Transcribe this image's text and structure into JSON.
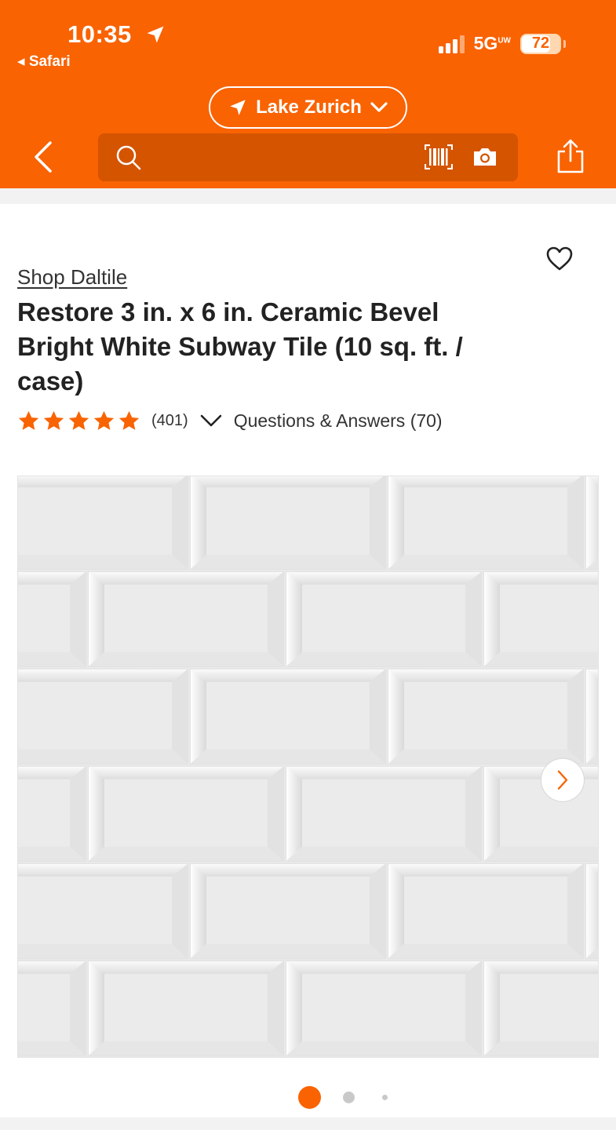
{
  "status_bar": {
    "time": "10:35",
    "back_app": "◂ Safari",
    "network": "5G",
    "network_sup": "UW",
    "battery": "72"
  },
  "header": {
    "store_name": "Lake Zurich",
    "search_placeholder": "",
    "accent_color": "#f96302"
  },
  "product": {
    "brand_link": "Shop Daltile",
    "title": "Restore 3 in. x 6 in. Ceramic Bevel Bright White Subway Tile (10 sq. ft. / case)",
    "rating_stars": 5,
    "review_count": "(401)",
    "qa_link": "Questions & Answers (70)"
  },
  "gallery": {
    "current_index": 1,
    "total_dots": 3
  },
  "icons": [
    "location-arrow-icon",
    "chevron-down-icon",
    "back-chevron-icon",
    "search-icon",
    "barcode-icon",
    "camera-icon",
    "share-icon",
    "heart-icon",
    "star-icon",
    "chevron-right-icon"
  ]
}
